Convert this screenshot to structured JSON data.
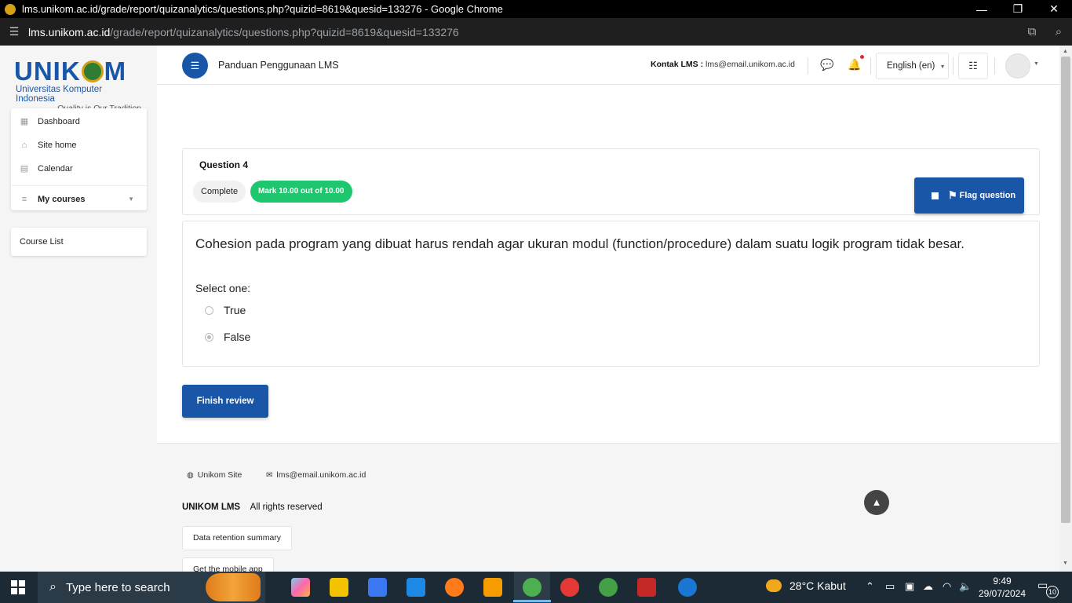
{
  "window": {
    "title": "lms.unikom.ac.id/grade/report/quizanalytics/questions.php?quizid=8619&quesid=133276 - Google Chrome",
    "controls": [
      "—",
      "❐",
      "✕"
    ]
  },
  "addressbar": {
    "host": "lms.unikom.ac.id",
    "path": "/grade/report/quizanalytics/questions.php?quizid=8619&quesid=133276"
  },
  "logo": {
    "word_left": "UNIK",
    "word_right": "M",
    "subtitle": "Universitas Komputer Indonesia",
    "tagline": "Quality is Our Tradition"
  },
  "sidebar": {
    "items": [
      {
        "label": "Dashboard",
        "icon": "dashboard-icon"
      },
      {
        "label": "Site home",
        "icon": "home-icon"
      },
      {
        "label": "Calendar",
        "icon": "calendar-icon"
      }
    ],
    "my_courses": "My courses",
    "course_list": "Course List"
  },
  "topnav": {
    "guide": "Panduan Penggunaan LMS",
    "contact_label": "Kontak LMS :",
    "contact_email": "lms@email.unikom.ac.id",
    "language": "English (en)"
  },
  "question": {
    "number": "Question 4",
    "state": "Complete",
    "mark": "Mark 10.00 out of 10.00",
    "flag": "Flag question",
    "text": "Cohesion pada program yang dibuat harus rendah agar ukuran modul (function/procedure) dalam suatu logik program tidak besar.",
    "prompt": "Select one:",
    "options": [
      {
        "label": "True",
        "selected": false
      },
      {
        "label": "False",
        "selected": true
      }
    ]
  },
  "finish_review": "Finish review",
  "footer": {
    "site_link": "Unikom Site",
    "email_link": "lms@email.unikom.ac.id",
    "brand": "UNIKOM LMS",
    "rights": "All rights reserved",
    "retention": "Data retention summary",
    "mobile": "Get the mobile app"
  },
  "taskbar": {
    "search_placeholder": "Type here to search",
    "weather": "28°C  Kabut",
    "time": "9:49",
    "date": "29/07/2024",
    "notification_count": "10"
  },
  "colors": {
    "primary": "#1a56a8",
    "success": "#1ec66e"
  }
}
